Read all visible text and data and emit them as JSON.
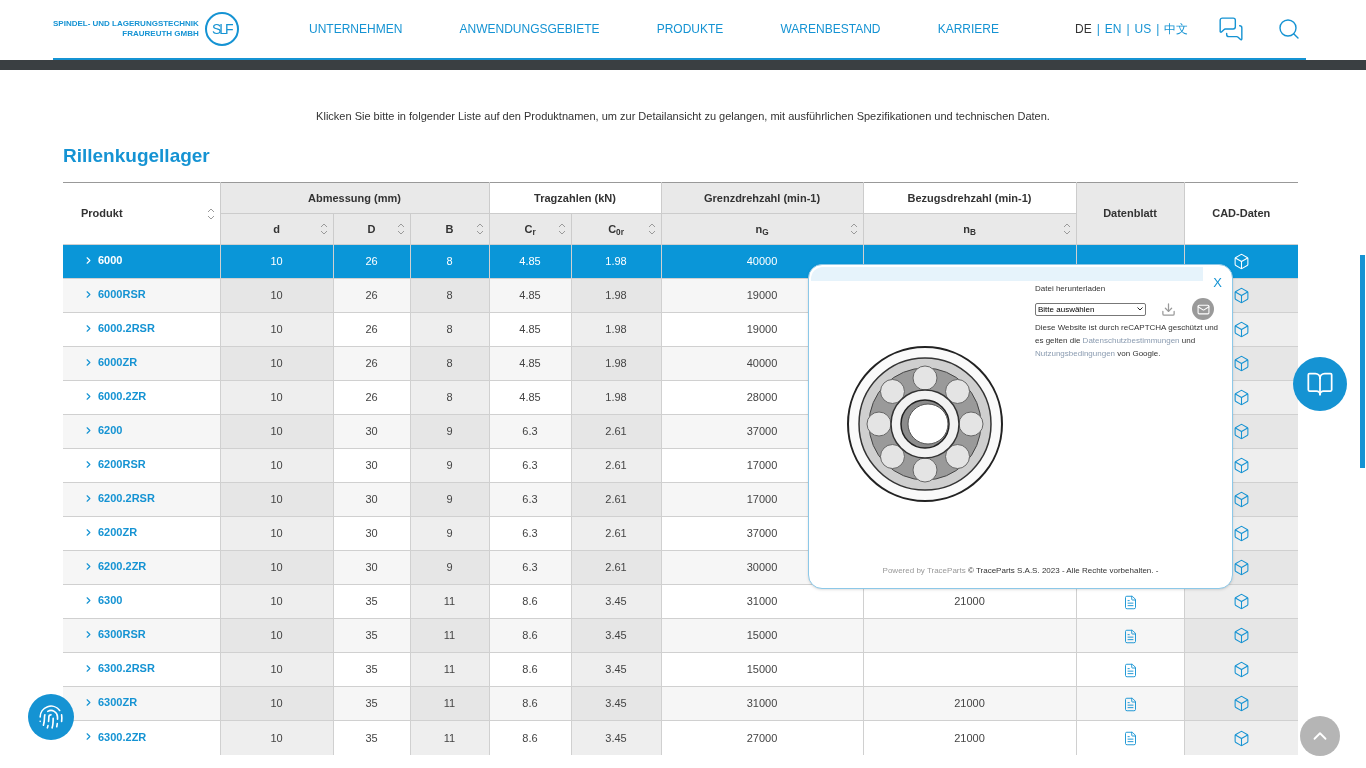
{
  "header": {
    "logo_text_1": "SPINDEL- UND LAGERUNGSTECHNIK",
    "logo_text_2": "FRAUREUTH GMBH",
    "logo_mark": "SLF",
    "nav": [
      "UNTERNEHMEN",
      "ANWENDUNGSGEBIETE",
      "PRODUKTE",
      "WARENBESTAND",
      "KARRIERE"
    ],
    "separator": "|",
    "languages": [
      {
        "label": "DE",
        "selected": true
      },
      {
        "label": "EN",
        "selected": false
      },
      {
        "label": "US",
        "selected": false
      },
      {
        "label": "中文",
        "selected": false
      }
    ]
  },
  "intro": "Klicken Sie bitte in folgender Liste auf den Produktnamen, um zur Detailansicht zu gelangen, mit ausführlichen Spezifikationen und technischen Daten.",
  "title": "Rillenkugellager",
  "table": {
    "product_header": "Produkt",
    "groups": [
      {
        "label": "Abmessung (mm)",
        "columns": [
          "d",
          "D",
          "B"
        ]
      },
      {
        "label": "Tragzahlen (kN)",
        "columns": [
          "C$_{r}$",
          "C$_{0r}$"
        ]
      },
      {
        "label": "Grenzdrehzahl (min-1)",
        "columns": [
          "n$_{G}$"
        ]
      },
      {
        "label": "Bezugsdrehzahl (min-1)",
        "columns": [
          "n$_{B}$"
        ]
      }
    ],
    "datasheet_header": "Datenblatt",
    "cad_header": "CAD-Daten",
    "rows": [
      {
        "product": "6000",
        "values": [
          "10",
          "26",
          "8",
          "4.85",
          "1.98",
          "40000"
        ],
        "selected": true,
        "datasheet": false
      },
      {
        "product": "6000RSR",
        "values": [
          "10",
          "26",
          "8",
          "4.85",
          "1.98",
          "19000"
        ],
        "selected": false,
        "datasheet": false
      },
      {
        "product": "6000.2RSR",
        "values": [
          "10",
          "26",
          "8",
          "4.85",
          "1.98",
          "19000"
        ],
        "selected": false,
        "datasheet": false
      },
      {
        "product": "6000ZR",
        "values": [
          "10",
          "26",
          "8",
          "4.85",
          "1.98",
          "40000"
        ],
        "selected": false,
        "datasheet": false
      },
      {
        "product": "6000.2ZR",
        "values": [
          "10",
          "26",
          "8",
          "4.85",
          "1.98",
          "28000"
        ],
        "selected": false,
        "datasheet": false
      },
      {
        "product": "6200",
        "values": [
          "10",
          "30",
          "9",
          "6.3",
          "2.61",
          "37000"
        ],
        "selected": false,
        "datasheet": false
      },
      {
        "product": "6200RSR",
        "values": [
          "10",
          "30",
          "9",
          "6.3",
          "2.61",
          "17000"
        ],
        "selected": false,
        "datasheet": false
      },
      {
        "product": "6200.2RSR",
        "values": [
          "10",
          "30",
          "9",
          "6.3",
          "2.61",
          "17000"
        ],
        "selected": false,
        "datasheet": false
      },
      {
        "product": "6200ZR",
        "values": [
          "10",
          "30",
          "9",
          "6.3",
          "2.61",
          "37000"
        ],
        "selected": false,
        "datasheet": false
      },
      {
        "product": "6200.2ZR",
        "values": [
          "10",
          "30",
          "9",
          "6.3",
          "2.61",
          "30000"
        ],
        "selected": false,
        "datasheet": false
      },
      {
        "product": "6300",
        "values": [
          "10",
          "35",
          "11",
          "8.6",
          "3.45",
          "31000",
          "21000"
        ],
        "selected": false,
        "datasheet": true
      },
      {
        "product": "6300RSR",
        "values": [
          "10",
          "35",
          "11",
          "8.6",
          "3.45",
          "15000"
        ],
        "selected": false,
        "datasheet": true
      },
      {
        "product": "6300.2RSR",
        "values": [
          "10",
          "35",
          "11",
          "8.6",
          "3.45",
          "15000"
        ],
        "selected": false,
        "datasheet": true
      },
      {
        "product": "6300ZR",
        "values": [
          "10",
          "35",
          "11",
          "8.6",
          "3.45",
          "31000",
          "21000"
        ],
        "selected": false,
        "datasheet": true
      },
      {
        "product": "6300.2ZR",
        "values": [
          "10",
          "35",
          "11",
          "8.6",
          "3.45",
          "27000",
          "21000"
        ],
        "selected": false,
        "datasheet": true
      }
    ]
  },
  "popup": {
    "close": "X",
    "download_label": "Datei herunterladen",
    "select_value": "Bitte auswählen",
    "captcha_1": "Diese Website ist durch reCAPTCHA geschützt und es gelten die",
    "privacy_link": "Datenschutzbestimmungen",
    "captcha_2": "und",
    "terms_link": "Nutzungsbedingungen",
    "captcha_3": "von Google.",
    "powered": "Powered by",
    "powered_link": "TraceParts",
    "copyright": "© TraceParts S.A.S. 2023 - Alle Rechte vorbehalten. -"
  }
}
